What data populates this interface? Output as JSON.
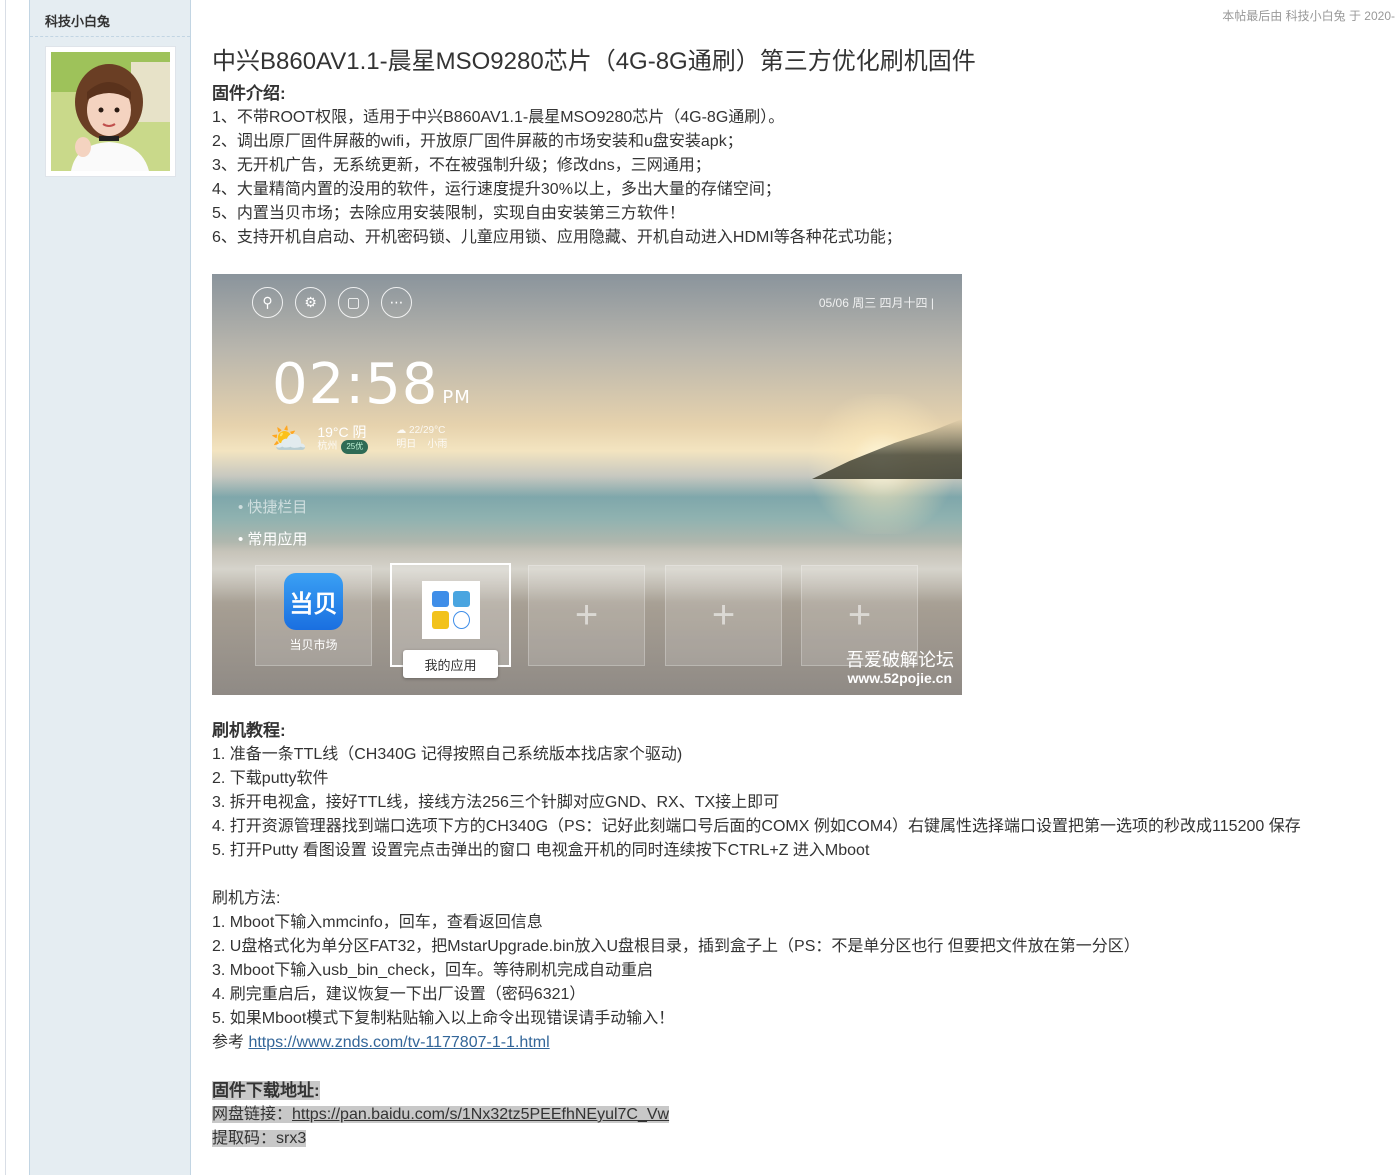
{
  "author": {
    "name": "科技小白兔"
  },
  "post_meta": "本帖最后由 科技小白兔 于 2020-",
  "post": {
    "title": "中兴B860AV1.1-晨星MSO9280芯片（4G-8G通刷）第三方优化刷机固件",
    "intro_head": "固件介绍:",
    "intro": [
      "1、不带ROOT权限，适用于中兴B860AV1.1-晨星MSO9280芯片（4G-8G通刷）。",
      "2、调出原厂固件屏蔽的wifi，开放原厂固件屏蔽的市场安装和u盘安装apk；",
      "3、无开机广告，无系统更新，不在被强制升级；修改dns，三网通用；",
      "4、大量精简内置的没用的软件，运行速度提升30%以上，多出大量的存储空间；",
      "5、内置当贝市场；去除应用安装限制，实现自由安装第三方软件！",
      "6、支持开机自启动、开机密码锁、儿童应用锁、应用隐藏、开机自动进入HDMI等各种花式功能；"
    ],
    "tutorial_head": "刷机教程:",
    "tutorial": [
      "1. 准备一条TTL线（CH340G 记得按照自己系统版本找店家个驱动)",
      "2. 下载putty软件",
      "3. 拆开电视盒，接好TTL线，接线方法256三个针脚对应GND、RX、TX接上即可",
      "4. 打开资源管理器找到端口选项下方的CH340G（PS：记好此刻端口号后面的COMX 例如COM4）右键属性选择端口设置把第一选项的秒改成115200 保存",
      "5. 打开Putty 看图设置 设置完点击弹出的窗口 电视盒开机的同时连续按下CTRL+Z 进入Mboot"
    ],
    "method_head": "刷机方法:",
    "method": [
      "1. Mboot下输入mmcinfo，回车，查看返回信息",
      "2. U盘格式化为单分区FAT32，把MstarUpgrade.bin放入U盘根目录，插到盒子上（PS：不是单分区也行 但要把文件放在第一分区）",
      "3. Mboot下输入usb_bin_check，回车。等待刷机完成自动重启",
      "4. 刷完重启后，建议恢复一下出厂设置（密码6321）",
      "5. 如果Mboot模式下复制粘贴输入以上命令出现错误请手动输入！"
    ],
    "ref_prefix": "参考 ",
    "ref_link": "https://www.znds.com/tv-1177807-1-1.html",
    "download_head": "固件下载地址:",
    "pan_prefix": "网盘链接：",
    "pan_link": "https://pan.baidu.com/s/1Nx32tz5PEEfhNEyul7C_Vw",
    "code_line": "提取码：srx3"
  },
  "tv_screenshot": {
    "date": "05/06   周三   四月十四   |",
    "time": "02:58",
    "ampm": "PM",
    "temp": "19°C 阴",
    "city": "杭州",
    "aqi": "25优",
    "tomorrow_range": "22/29°C",
    "tomorrow_label": "明日",
    "tomorrow_weather": "小雨",
    "nav_quick": "• 快捷栏目",
    "nav_common": "• 常用应用",
    "dangbei_icon_text": "当贝",
    "dangbei_label": "当贝市场",
    "myapps_label": "我的应用",
    "watermark_cn": "吾爱破解论坛",
    "watermark_url": "www.52pojie.cn"
  }
}
